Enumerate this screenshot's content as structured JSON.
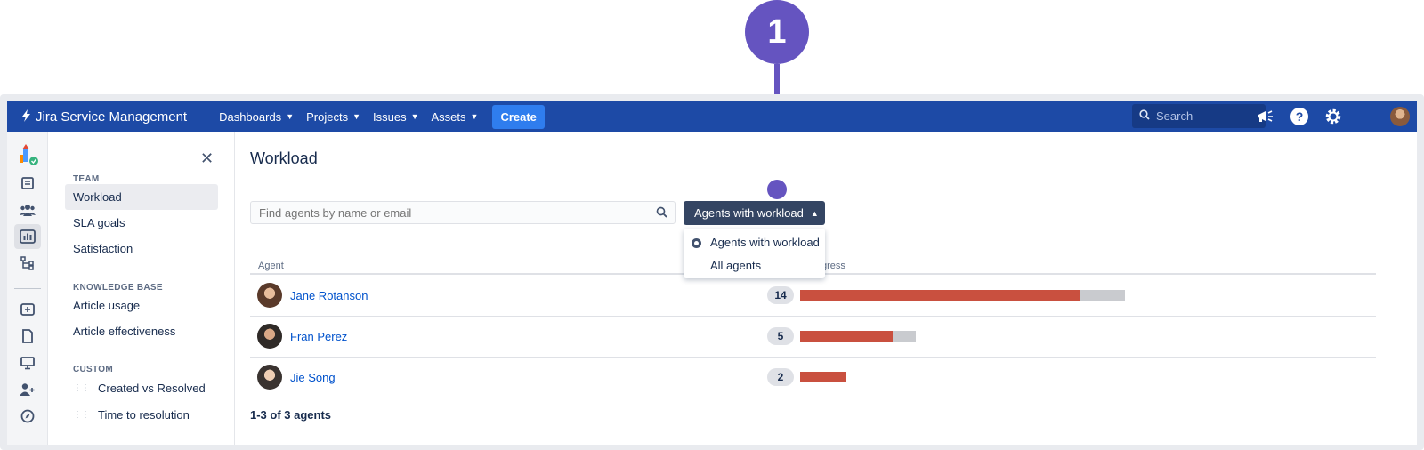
{
  "callout": {
    "number": "1",
    "color": "#6554c0"
  },
  "topnav": {
    "brand": "Jira Service Management",
    "menus": [
      {
        "label": "Dashboards"
      },
      {
        "label": "Projects"
      },
      {
        "label": "Issues"
      },
      {
        "label": "Assets"
      }
    ],
    "create_label": "Create",
    "search_placeholder": "Search",
    "bg_color": "#1d4aa6"
  },
  "sidebar": {
    "sections": [
      {
        "label": "TEAM",
        "items": [
          "Workload",
          "SLA goals",
          "Satisfaction"
        ]
      },
      {
        "label": "KNOWLEDGE BASE",
        "items": [
          "Article usage",
          "Article effectiveness"
        ]
      },
      {
        "label": "CUSTOM",
        "items": [
          "Created vs Resolved",
          "Time to resolution"
        ]
      }
    ],
    "active_item": "Workload"
  },
  "main": {
    "title": "Workload",
    "find_placeholder": "Find agents by name or email",
    "filter_label": "Agents with workload",
    "dropdown": {
      "options": [
        "Agents with workload",
        "All agents"
      ],
      "selected": "Agents with workload"
    },
    "columns": {
      "agent": "Agent",
      "progress": "gress"
    },
    "agents": [
      {
        "name": "Jane Rotanson",
        "count": "14",
        "workload_total": 14,
        "workload_max": 14,
        "progress_fraction": 0.86
      },
      {
        "name": "Fran Perez",
        "count": "5",
        "workload_total": 5,
        "workload_max": 14,
        "progress_fraction": 0.8
      },
      {
        "name": "Jie Song",
        "count": "2",
        "workload_total": 2,
        "workload_max": 14,
        "progress_fraction": 1.0
      }
    ],
    "footer": "1-3 of 3 agents",
    "bar_fill_color": "#c9503f",
    "bar_track_color": "#c9cbcf"
  }
}
